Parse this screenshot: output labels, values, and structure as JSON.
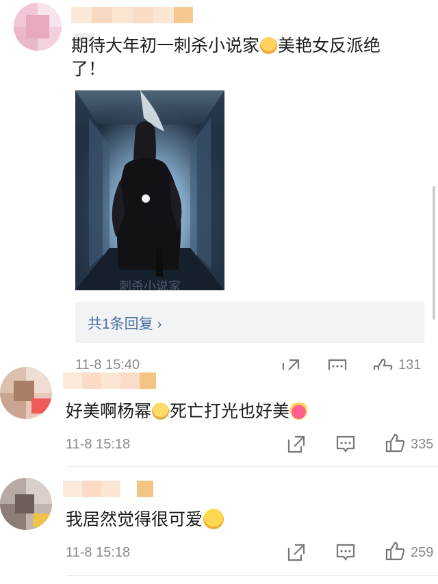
{
  "comments": [
    {
      "text_line1": "期待大年初一刺杀小说家",
      "text_line1_after": "美艳女反派绝",
      "text_line2": "了！",
      "emoji_1": "scream-face-emoji",
      "reply_label": "共1条回复",
      "reply_chevron": "›",
      "time": "11-8 15:40",
      "likes": "131"
    },
    {
      "text_before": "好美啊杨幂",
      "text_middle": "死亡打光也好美",
      "emoji_1": "pleading-face-emoji",
      "emoji_2": "heart-with-ribbon-emoji",
      "time": "11-8 15:18",
      "likes": "335"
    },
    {
      "text_before": "我居然觉得很可爱",
      "emoji_1": "smiling-face-emoji",
      "time": "11-8 15:18",
      "likes": "259"
    }
  ],
  "poster": {
    "caption": "刺杀小说家"
  },
  "colors": {
    "link_blue": "#4a6fa5",
    "meta_gray": "#8a8a8a",
    "reply_bg": "#f2f3f5"
  },
  "icons": {
    "share": "share-icon",
    "comment": "comment-icon",
    "like": "thumbs-up-icon"
  }
}
